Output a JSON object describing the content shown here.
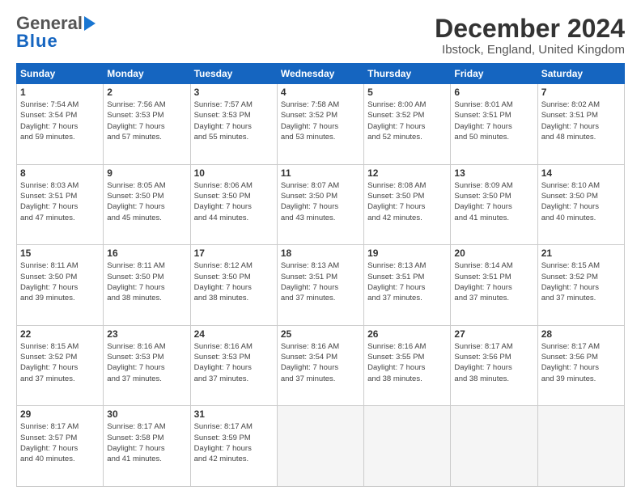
{
  "header": {
    "logo_line1": "General",
    "logo_line2": "Blue",
    "month_title": "December 2024",
    "location": "Ibstock, England, United Kingdom"
  },
  "days_of_week": [
    "Sunday",
    "Monday",
    "Tuesday",
    "Wednesday",
    "Thursday",
    "Friday",
    "Saturday"
  ],
  "weeks": [
    [
      {
        "day": "1",
        "info": "Sunrise: 7:54 AM\nSunset: 3:54 PM\nDaylight: 7 hours\nand 59 minutes."
      },
      {
        "day": "2",
        "info": "Sunrise: 7:56 AM\nSunset: 3:53 PM\nDaylight: 7 hours\nand 57 minutes."
      },
      {
        "day": "3",
        "info": "Sunrise: 7:57 AM\nSunset: 3:53 PM\nDaylight: 7 hours\nand 55 minutes."
      },
      {
        "day": "4",
        "info": "Sunrise: 7:58 AM\nSunset: 3:52 PM\nDaylight: 7 hours\nand 53 minutes."
      },
      {
        "day": "5",
        "info": "Sunrise: 8:00 AM\nSunset: 3:52 PM\nDaylight: 7 hours\nand 52 minutes."
      },
      {
        "day": "6",
        "info": "Sunrise: 8:01 AM\nSunset: 3:51 PM\nDaylight: 7 hours\nand 50 minutes."
      },
      {
        "day": "7",
        "info": "Sunrise: 8:02 AM\nSunset: 3:51 PM\nDaylight: 7 hours\nand 48 minutes."
      }
    ],
    [
      {
        "day": "8",
        "info": "Sunrise: 8:03 AM\nSunset: 3:51 PM\nDaylight: 7 hours\nand 47 minutes."
      },
      {
        "day": "9",
        "info": "Sunrise: 8:05 AM\nSunset: 3:50 PM\nDaylight: 7 hours\nand 45 minutes."
      },
      {
        "day": "10",
        "info": "Sunrise: 8:06 AM\nSunset: 3:50 PM\nDaylight: 7 hours\nand 44 minutes."
      },
      {
        "day": "11",
        "info": "Sunrise: 8:07 AM\nSunset: 3:50 PM\nDaylight: 7 hours\nand 43 minutes."
      },
      {
        "day": "12",
        "info": "Sunrise: 8:08 AM\nSunset: 3:50 PM\nDaylight: 7 hours\nand 42 minutes."
      },
      {
        "day": "13",
        "info": "Sunrise: 8:09 AM\nSunset: 3:50 PM\nDaylight: 7 hours\nand 41 minutes."
      },
      {
        "day": "14",
        "info": "Sunrise: 8:10 AM\nSunset: 3:50 PM\nDaylight: 7 hours\nand 40 minutes."
      }
    ],
    [
      {
        "day": "15",
        "info": "Sunrise: 8:11 AM\nSunset: 3:50 PM\nDaylight: 7 hours\nand 39 minutes."
      },
      {
        "day": "16",
        "info": "Sunrise: 8:11 AM\nSunset: 3:50 PM\nDaylight: 7 hours\nand 38 minutes."
      },
      {
        "day": "17",
        "info": "Sunrise: 8:12 AM\nSunset: 3:50 PM\nDaylight: 7 hours\nand 38 minutes."
      },
      {
        "day": "18",
        "info": "Sunrise: 8:13 AM\nSunset: 3:51 PM\nDaylight: 7 hours\nand 37 minutes."
      },
      {
        "day": "19",
        "info": "Sunrise: 8:13 AM\nSunset: 3:51 PM\nDaylight: 7 hours\nand 37 minutes."
      },
      {
        "day": "20",
        "info": "Sunrise: 8:14 AM\nSunset: 3:51 PM\nDaylight: 7 hours\nand 37 minutes."
      },
      {
        "day": "21",
        "info": "Sunrise: 8:15 AM\nSunset: 3:52 PM\nDaylight: 7 hours\nand 37 minutes."
      }
    ],
    [
      {
        "day": "22",
        "info": "Sunrise: 8:15 AM\nSunset: 3:52 PM\nDaylight: 7 hours\nand 37 minutes."
      },
      {
        "day": "23",
        "info": "Sunrise: 8:16 AM\nSunset: 3:53 PM\nDaylight: 7 hours\nand 37 minutes."
      },
      {
        "day": "24",
        "info": "Sunrise: 8:16 AM\nSunset: 3:53 PM\nDaylight: 7 hours\nand 37 minutes."
      },
      {
        "day": "25",
        "info": "Sunrise: 8:16 AM\nSunset: 3:54 PM\nDaylight: 7 hours\nand 37 minutes."
      },
      {
        "day": "26",
        "info": "Sunrise: 8:16 AM\nSunset: 3:55 PM\nDaylight: 7 hours\nand 38 minutes."
      },
      {
        "day": "27",
        "info": "Sunrise: 8:17 AM\nSunset: 3:56 PM\nDaylight: 7 hours\nand 38 minutes."
      },
      {
        "day": "28",
        "info": "Sunrise: 8:17 AM\nSunset: 3:56 PM\nDaylight: 7 hours\nand 39 minutes."
      }
    ],
    [
      {
        "day": "29",
        "info": "Sunrise: 8:17 AM\nSunset: 3:57 PM\nDaylight: 7 hours\nand 40 minutes."
      },
      {
        "day": "30",
        "info": "Sunrise: 8:17 AM\nSunset: 3:58 PM\nDaylight: 7 hours\nand 41 minutes."
      },
      {
        "day": "31",
        "info": "Sunrise: 8:17 AM\nSunset: 3:59 PM\nDaylight: 7 hours\nand 42 minutes."
      },
      {
        "day": "",
        "info": ""
      },
      {
        "day": "",
        "info": ""
      },
      {
        "day": "",
        "info": ""
      },
      {
        "day": "",
        "info": ""
      }
    ]
  ]
}
